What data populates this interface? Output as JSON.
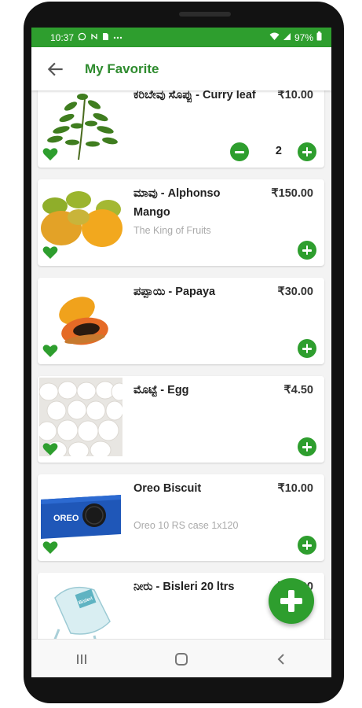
{
  "status_bar": {
    "time": "10:37",
    "left_icons": [
      "whatsapp-icon",
      "nfc-icon",
      "sim-icon",
      "more-icon"
    ],
    "battery": "97%"
  },
  "app_bar": {
    "title": "My Favorite"
  },
  "products": [
    {
      "name": "ಕರಿಬೇವು ಸೊಪ್ಪು - Curry leaf",
      "price": "₹10.00",
      "description": "",
      "quantity": "2",
      "image": "curry-leaf-image"
    },
    {
      "name": "ಮಾವು - Alphonso Mango",
      "price": "₹150.00",
      "description": "The King of Fruits",
      "image": "mango-image"
    },
    {
      "name": "ಪಪ್ಪಾಯಿ - Papaya",
      "price": "₹30.00",
      "description": "",
      "image": "papaya-image"
    },
    {
      "name": "ಮೊಟ್ಟೆ - Egg",
      "price": "₹4.50",
      "description": "",
      "image": "eggs-image"
    },
    {
      "name": "Oreo Biscuit",
      "price": "₹10.00",
      "description": "Oreo 10 RS case 1x120",
      "image": "oreo-image"
    },
    {
      "name": "ನೀರು - Bisleri 20 ltrs",
      "price": "₹60.00",
      "description": "",
      "image": "bisleri-can-image"
    }
  ],
  "oreo_brand_text": "OREO",
  "bisleri_brand_text": "Bisleri",
  "colors": {
    "primary": "#2e9e2e",
    "title": "#2e8b2e"
  },
  "nav": [
    "recents-button",
    "home-button",
    "back-button"
  ]
}
